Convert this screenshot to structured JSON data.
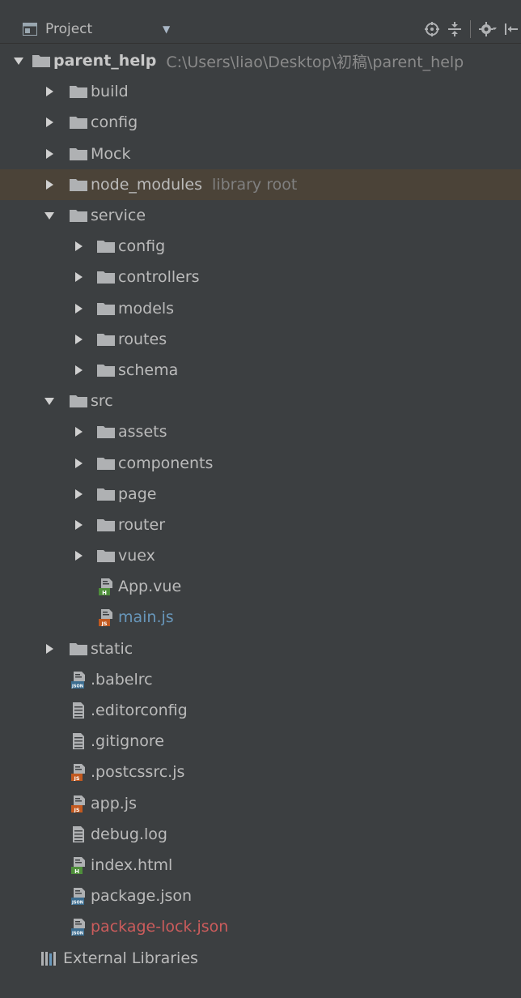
{
  "header": {
    "title": "Project",
    "dropdown_icon": "dropdown-arrow-icon",
    "toolbar": [
      "locate-icon",
      "collapse-all-icon",
      "settings-gear-icon",
      "hide-icon"
    ]
  },
  "colors": {
    "background": "#3c3f41",
    "folder": "#afb1b3",
    "highlight_row": "#4b4338",
    "modified_blue": "#6897bb",
    "unversioned_red": "#cc5c5c"
  },
  "tree": {
    "root": {
      "name": "parent_help",
      "path": "C:\\Users\\liao\\Desktop\\初稿\\parent_help",
      "expanded": true
    },
    "items": [
      {
        "name": "build",
        "type": "folder",
        "expanded": false
      },
      {
        "name": "config",
        "type": "folder",
        "expanded": false
      },
      {
        "name": "Mock",
        "type": "folder",
        "expanded": false
      },
      {
        "name": "node_modules",
        "type": "folder",
        "expanded": false,
        "hint": "library root"
      },
      {
        "name": "service",
        "type": "folder",
        "expanded": true
      },
      {
        "name": "config",
        "type": "folder",
        "expanded": false
      },
      {
        "name": "controllers",
        "type": "folder",
        "expanded": false
      },
      {
        "name": "models",
        "type": "folder",
        "expanded": false
      },
      {
        "name": "routes",
        "type": "folder",
        "expanded": false
      },
      {
        "name": "schema",
        "type": "folder",
        "expanded": false
      },
      {
        "name": "src",
        "type": "folder",
        "expanded": true
      },
      {
        "name": "assets",
        "type": "folder",
        "expanded": false
      },
      {
        "name": "components",
        "type": "folder",
        "expanded": false
      },
      {
        "name": "page",
        "type": "folder",
        "expanded": false
      },
      {
        "name": "router",
        "type": "folder",
        "expanded": false
      },
      {
        "name": "vuex",
        "type": "folder",
        "expanded": false
      },
      {
        "name": "App.vue",
        "type": "file",
        "icon": "vue-file-icon"
      },
      {
        "name": "main.js",
        "type": "file",
        "icon": "js-file-icon"
      },
      {
        "name": "static",
        "type": "folder",
        "expanded": false
      },
      {
        "name": ".babelrc",
        "type": "file",
        "icon": "json-file-icon"
      },
      {
        "name": ".editorconfig",
        "type": "file",
        "icon": "text-file-icon"
      },
      {
        "name": ".gitignore",
        "type": "file",
        "icon": "text-file-icon"
      },
      {
        "name": ".postcssrc.js",
        "type": "file",
        "icon": "js-file-icon"
      },
      {
        "name": "app.js",
        "type": "file",
        "icon": "js-file-icon"
      },
      {
        "name": "debug.log",
        "type": "file",
        "icon": "text-file-icon"
      },
      {
        "name": "index.html",
        "type": "file",
        "icon": "html-file-icon"
      },
      {
        "name": "package.json",
        "type": "file",
        "icon": "json-file-icon"
      },
      {
        "name": "package-lock.json",
        "type": "file",
        "icon": "json-file-icon"
      }
    ],
    "external_libraries": "External Libraries"
  }
}
